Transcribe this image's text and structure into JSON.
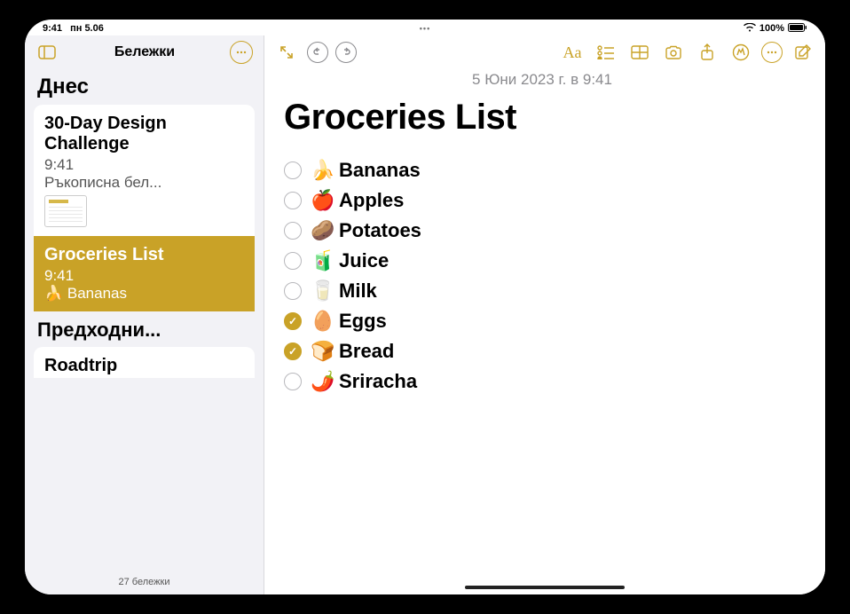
{
  "status": {
    "time": "9:41",
    "date": "пн 5.06",
    "wifi": "wifi-icon",
    "battery_pct": "100%"
  },
  "sidebar": {
    "title": "Бележки",
    "section_today": "Днес",
    "section_prev": "Предходни...",
    "footer": "27 бележки",
    "notes": [
      {
        "title": "30-Day Design Challenge",
        "time": "9:41",
        "preview": "Ръкописна бел...",
        "selected": false,
        "has_thumb": true
      },
      {
        "title": "Groceries List",
        "time": "9:41",
        "preview": "🍌 Bananas",
        "selected": true,
        "has_thumb": false
      }
    ],
    "prev_notes": [
      {
        "title": "Roadtrip"
      }
    ]
  },
  "editor": {
    "date": "5 Юни 2023 г. в 9:41",
    "title": "Groceries List",
    "items": [
      {
        "emoji": "🍌",
        "label": "Bananas",
        "checked": false
      },
      {
        "emoji": "🍎",
        "label": "Apples",
        "checked": false
      },
      {
        "emoji": "🥔",
        "label": "Potatoes",
        "checked": false
      },
      {
        "emoji": "🧃",
        "label": "Juice",
        "checked": false
      },
      {
        "emoji": "🥛",
        "label": "Milk",
        "checked": false
      },
      {
        "emoji": "🥚",
        "label": "Eggs",
        "checked": true
      },
      {
        "emoji": "🍞",
        "label": "Bread",
        "checked": true
      },
      {
        "emoji": "🌶️",
        "label": "Sriracha",
        "checked": false
      }
    ]
  },
  "toolbar": {
    "format_label": "Aa"
  }
}
